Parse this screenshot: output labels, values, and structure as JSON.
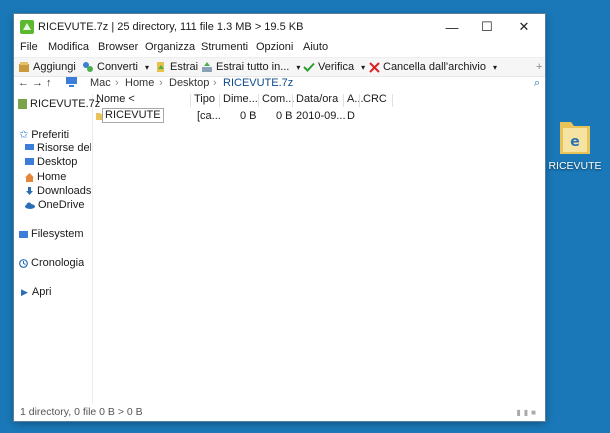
{
  "window": {
    "title": "RICEVUTE.7z | 25 directory, 111 file 1.3 MB > 19.5 KB",
    "minimize": "—",
    "maximize": "☐",
    "close": "✕"
  },
  "menu": [
    "File",
    "Modifica",
    "Browser",
    "Organizza",
    "Strumenti",
    "Opzioni",
    "Aiuto"
  ],
  "toolbar": {
    "add": "Aggiungi",
    "convert": "Converti",
    "extract": "Estrai",
    "extract_all": "Estrai tutto in...",
    "verify": "Verifica",
    "delete": "Cancella dall'archivio",
    "more": "+"
  },
  "address": {
    "back": "←",
    "forward": "→",
    "up": "↑",
    "crumbs": [
      "Mac",
      "Home",
      "Desktop",
      "RICEVUTE.7z"
    ],
    "search": "⌕"
  },
  "sidebar": {
    "archive": "RICEVUTE.7z",
    "favorites": "Preferiti",
    "items": [
      "Risorse del c",
      "Desktop",
      "Home",
      "Downloads",
      "OneDrive"
    ],
    "filesystem": "Filesystem",
    "history": "Cronologia",
    "open": "Apri"
  },
  "columns": [
    "Nome <",
    "Tipo",
    "Dime...",
    "Com...",
    "Data/ora",
    "A...",
    "CRC"
  ],
  "rows": [
    {
      "name": "RICEVUTE",
      "type": "[ca...",
      "size": "0 B",
      "compressed": "0 B",
      "date": "2010-09...",
      "attr": "D",
      "crc": ""
    }
  ],
  "status": "1 directory, 0 file 0 B > 0 B",
  "desktop": {
    "icon_label": "RICEVUTE"
  },
  "colors": {
    "desktop": "#1a78b8",
    "accent": "#0066cc"
  }
}
